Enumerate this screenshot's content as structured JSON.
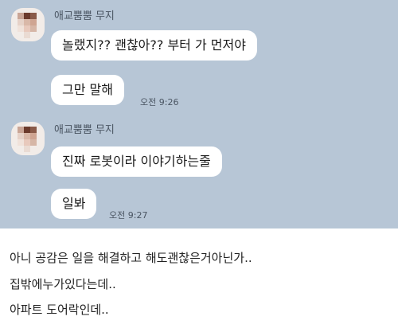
{
  "chat": {
    "groups": [
      {
        "sender": "애교뿜뿜 무지",
        "messages": [
          "놀랬지?? 괜찮아?? 부터 가 먼저야",
          "그만 말해"
        ],
        "time": "오전 9:26"
      },
      {
        "sender": "애교뿜뿜 무지",
        "messages": [
          "진짜 로봇이라 이야기하는줄",
          "일봐"
        ],
        "time": "오전 9:27"
      }
    ]
  },
  "comment": {
    "lines": [
      "아니 공감은 일을 해결하고 해도괜찮은거아닌가..",
      "집밖에누가있다는데..",
      "아파트 도어락인데.."
    ]
  },
  "colors": {
    "chat_background": "#b7c6d6",
    "bubble": "#ffffff",
    "page_background": "#ffffff"
  },
  "icons": {
    "avatar": "pixelated-profile-avatar"
  }
}
